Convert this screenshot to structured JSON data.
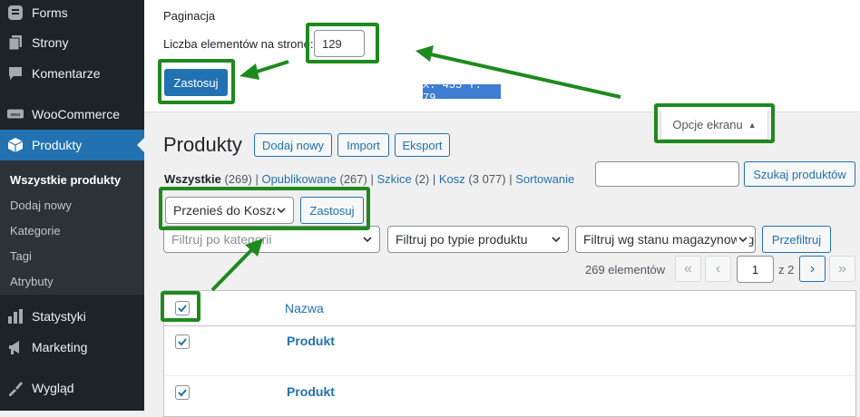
{
  "sidebar": {
    "items": [
      {
        "label": "Forms",
        "icon": "forms-icon"
      },
      {
        "label": "Strony",
        "icon": "pages-icon"
      },
      {
        "label": "Komentarze",
        "icon": "comments-icon"
      },
      {
        "label": "WooCommerce",
        "icon": "woocommerce-icon"
      },
      {
        "label": "Produkty",
        "icon": "products-icon"
      },
      {
        "label": "Statystyki",
        "icon": "analytics-icon"
      },
      {
        "label": "Marketing",
        "icon": "marketing-icon"
      },
      {
        "label": "Wygląd",
        "icon": "appearance-icon"
      }
    ],
    "submenu": [
      "Wszystkie produkty",
      "Dodaj nowy",
      "Kategorie",
      "Tagi",
      "Atrybuty"
    ]
  },
  "screen_options": {
    "title": "Paginacja",
    "per_page_label": "Liczba elementów na stronę:",
    "per_page_value": "129",
    "apply_label": "Zastosuj",
    "toggle_label": "Opcje ekranu",
    "coord_readout": "X: 455 Y: 79"
  },
  "header": {
    "title": "Produkty",
    "buttons": [
      "Dodaj nowy",
      "Import",
      "Eksport"
    ]
  },
  "views": [
    {
      "label": "Wszystkie",
      "count": "(269)"
    },
    {
      "label": "Opublikowane",
      "count": "(267)"
    },
    {
      "label": "Szkice",
      "count": "(2)"
    },
    {
      "label": "Kosz",
      "count": "(3 077)"
    },
    {
      "label": "Sortowanie",
      "count": ""
    }
  ],
  "search": {
    "button_label": "Szukaj produktów"
  },
  "bulk": {
    "selected": "Przenieś do Kosza",
    "apply_label": "Zastosuj"
  },
  "filters": {
    "category_placeholder": "Filtruj po kategorii",
    "type": "Filtruj po typie produktu",
    "stock": "Filtruj wg stanu magazynowego",
    "button_label": "Przefiltruj"
  },
  "pagination": {
    "items": "269 elementów",
    "current_page": "1",
    "of_text": "z 2",
    "first": "«",
    "prev": "‹",
    "next": "›",
    "last": "»"
  },
  "table": {
    "column_name": "Nazwa",
    "rows": [
      {
        "name": "Produkt",
        "checked": true
      },
      {
        "name": "Produkt",
        "checked": true
      }
    ]
  },
  "colors": {
    "accent": "#2271b1",
    "highlight": "#1e8a1e",
    "sidebar": "#1d2327"
  }
}
